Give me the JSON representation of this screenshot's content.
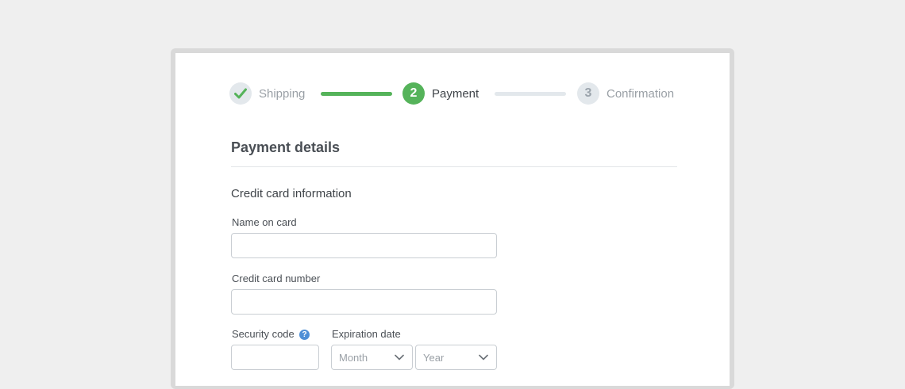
{
  "stepper": {
    "steps": [
      {
        "label": "Shipping",
        "status": "completed",
        "icon": "checkmark-icon"
      },
      {
        "label": "Payment",
        "number": "2",
        "status": "active"
      },
      {
        "label": "Confirmation",
        "number": "3",
        "status": "upcoming"
      }
    ]
  },
  "section": {
    "title": "Payment details",
    "subtitle": "Credit card information"
  },
  "fields": {
    "name_on_card": {
      "label": "Name on card",
      "value": "",
      "placeholder": ""
    },
    "card_number": {
      "label": "Credit card number",
      "value": "",
      "placeholder": ""
    },
    "security_code": {
      "label": "Security code",
      "value": "",
      "placeholder": "",
      "help_icon": "question-mark-icon",
      "help_symbol": "?"
    },
    "expiration": {
      "label": "Expiration date",
      "month": {
        "selected": "Month"
      },
      "year": {
        "selected": "Year"
      }
    }
  },
  "colors": {
    "accent": "#55b35a",
    "inactive": "#e3e8ec",
    "help_icon": "#4e8fd6",
    "text_dark": "#4a4f55"
  }
}
